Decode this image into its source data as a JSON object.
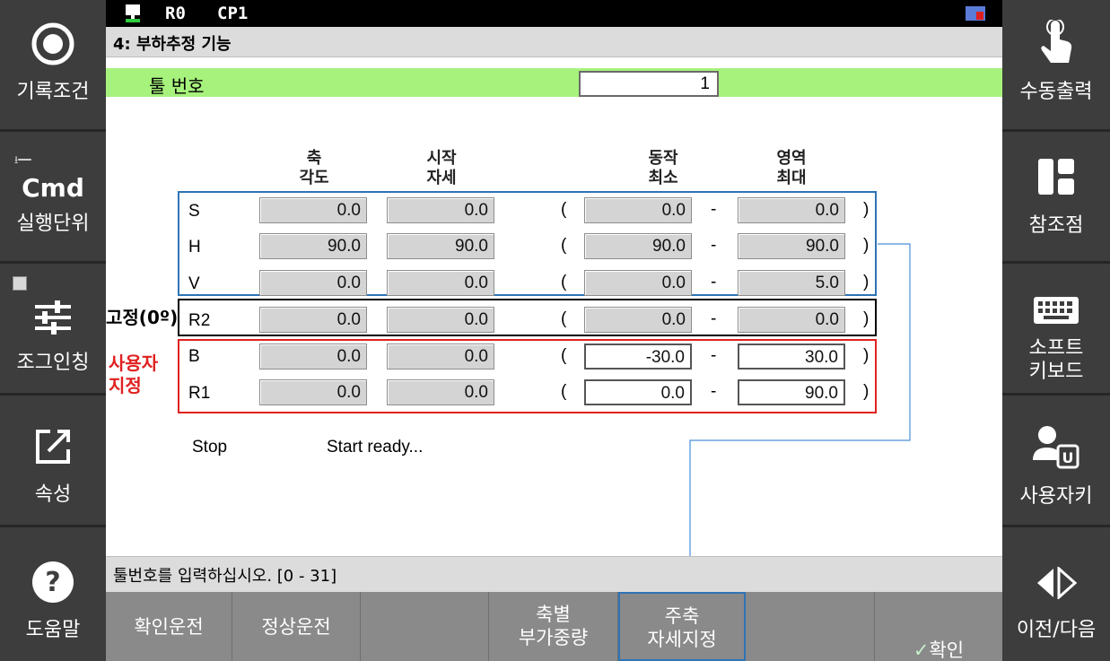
{
  "statusbar": {
    "robot": "R0",
    "cp": "CP1"
  },
  "title": "4: 부하추정 기능",
  "tool": {
    "label": "툴 번호",
    "value": "1"
  },
  "headers": {
    "axis_angle": "축\n각도",
    "start_pose": "시작\n자세",
    "motion_min": "동작\n최소",
    "range_max": "영역\n최대"
  },
  "rows": [
    {
      "axis": "S",
      "angle": "0.0",
      "start": "0.0",
      "min": "0.0",
      "max": "0.0"
    },
    {
      "axis": "H",
      "angle": "90.0",
      "start": "90.0",
      "min": "90.0",
      "max": "90.0"
    },
    {
      "axis": "V",
      "angle": "0.0",
      "start": "0.0",
      "min": "0.0",
      "max": "5.0"
    },
    {
      "axis": "R2",
      "angle": "0.0",
      "start": "0.0",
      "min": "0.0",
      "max": "0.0"
    },
    {
      "axis": "B",
      "angle": "0.0",
      "start": "0.0",
      "min": "-30.0",
      "max": "30.0"
    },
    {
      "axis": "R1",
      "angle": "0.0",
      "start": "0.0",
      "min": "0.0",
      "max": "90.0"
    }
  ],
  "annotations": {
    "fixed": "고정(0º)",
    "user_defined": "사용자\n지정"
  },
  "status": {
    "state": "Stop",
    "message": "Start ready..."
  },
  "hint": "툴번호를 입력하십시오. [0 - 31]",
  "left_buttons": [
    {
      "label": "기록조건",
      "icon": "record-circle-icon"
    },
    {
      "label": "실행단위",
      "icon": "cmd-icon",
      "icon_text": "Cmd"
    },
    {
      "label": "조그인칭",
      "icon": "sliders-icon"
    },
    {
      "label": "속성",
      "icon": "edit-box-icon"
    },
    {
      "label": "도움말",
      "icon": "help-icon"
    }
  ],
  "right_buttons": [
    {
      "label": "수동출력",
      "icon": "touch-hand-icon"
    },
    {
      "label": "참조점",
      "icon": "layout-icon"
    },
    {
      "label": "소프트\n키보드",
      "icon": "keyboard-icon"
    },
    {
      "label": "사용자키",
      "icon": "user-key-icon",
      "icon_text": "U"
    },
    {
      "label": "이전/다음",
      "icon": "prev-next-icon"
    }
  ],
  "bottom_buttons": [
    {
      "label": "확인운전"
    },
    {
      "label": "정상운전"
    },
    {
      "label": ""
    },
    {
      "label": "축별\n부가중량"
    },
    {
      "label": "주축\n자세지정"
    },
    {
      "label": ""
    },
    {
      "label": "확인"
    }
  ],
  "colors": {
    "green_row": "#a7f27c",
    "blue_box": "#2e74b5",
    "red_box": "#e02020",
    "annotation_red": "#e02020"
  }
}
